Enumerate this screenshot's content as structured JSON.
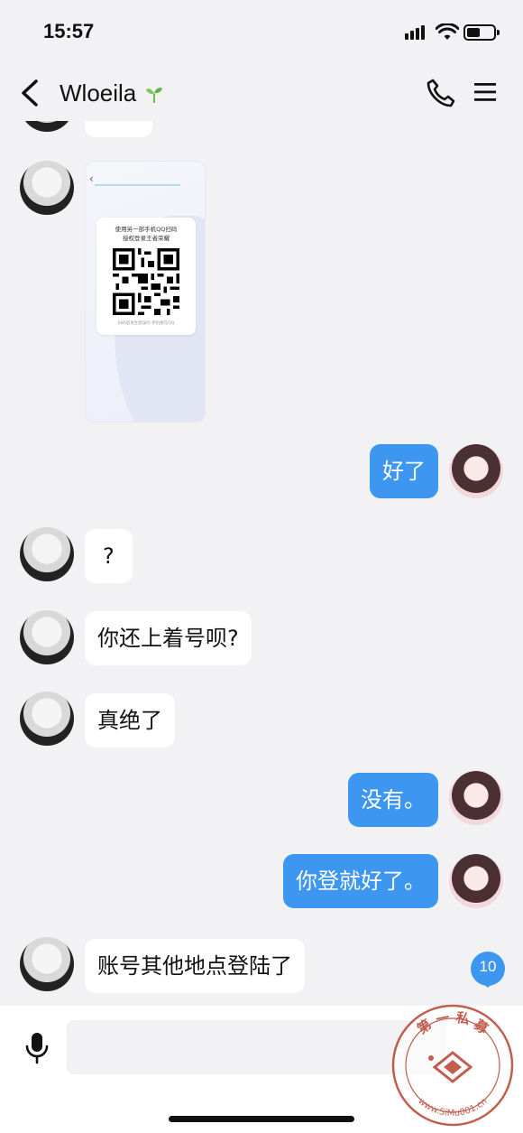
{
  "status_bar": {
    "time": "15:57"
  },
  "header": {
    "contact_name": "Wloeila",
    "status_icon": "sprout-icon"
  },
  "image_message": {
    "line1": "使用另一部手机QQ扫码",
    "line2": "授权登录王者荣耀",
    "footer": "扫码后发生错误吗  手机要在QQ"
  },
  "messages": [
    {
      "side": "out",
      "text": "好了"
    },
    {
      "side": "in",
      "text": "?"
    },
    {
      "side": "in",
      "text": "你还上着号呗?"
    },
    {
      "side": "in",
      "text": "真绝了"
    },
    {
      "side": "out",
      "text": "没有。"
    },
    {
      "side": "out",
      "text": "你登就好了。"
    },
    {
      "side": "in",
      "text": "账号其他地点登陆了"
    }
  ],
  "unread_badge": "10",
  "input": {
    "placeholder": ""
  },
  "watermark": {
    "top_text": "第 一 私 募",
    "bottom_text": "www.SiMu001.cn"
  },
  "colors": {
    "outgoing_bubble": "#3d97f0",
    "incoming_bubble": "#ffffff",
    "background": "#f2f2f4"
  }
}
